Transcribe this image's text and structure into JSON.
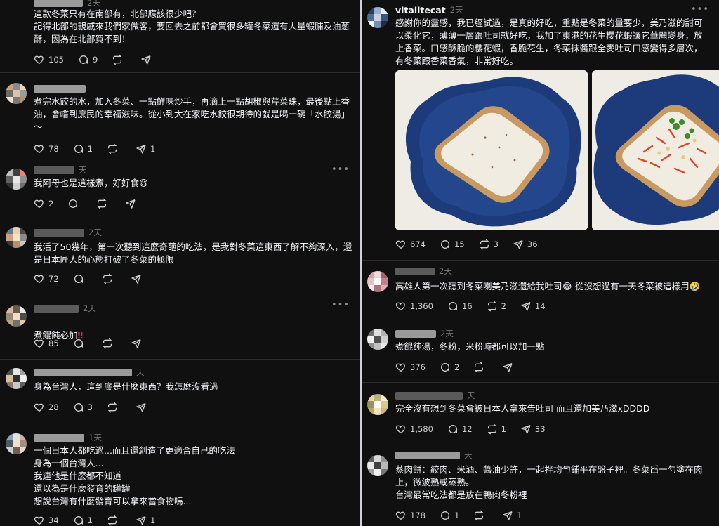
{
  "left": {
    "posts": [
      {
        "username": "",
        "time": "2天",
        "text": "這款冬菜只有在南部有，北部應該很少吧？\n記得北部的親戚來我們家做客，要回去之前都會買很多罐冬菜還有大量蝦脯及油蔥酥，因為在北部買不到！",
        "likes": "105",
        "replies": "9",
        "reposts": "",
        "shares": ""
      },
      {
        "username": "",
        "time": "",
        "text": "煮完水餃的水，加入冬菜、一點鮮味炒手，再滴上一點胡椒與芹菜珠，最後點上香油，會嚐到庶民的幸福滋味。從小到大在家吃水餃很期待的就是喝一碗「水餃湯」～",
        "likes": "78",
        "replies": "1",
        "reposts": "",
        "shares": "1"
      },
      {
        "username": "",
        "time": "天",
        "text": "我阿母也是這樣煮，好好食😋",
        "likes": "2",
        "replies": "",
        "reposts": "",
        "shares": ""
      },
      {
        "username": "",
        "time": "2天",
        "text": "我活了50幾年，第一次聽到這麼奇葩的吃法，是我對冬菜這東西了解不夠深入，還是日本匠人的心態打破了冬菜的極限",
        "likes": "72",
        "replies": "",
        "reposts": "",
        "shares": ""
      },
      {
        "username": "",
        "time": "2天",
        "text": "煮餛飩必加",
        "emoji": "‼",
        "likes": "85",
        "replies": "",
        "reposts": "",
        "shares": ""
      },
      {
        "username": "",
        "time": "天",
        "text": "身為台灣人，這到底是什麼東西？我怎麼沒看過",
        "likes": "28",
        "replies": "3",
        "reposts": "",
        "shares": ""
      },
      {
        "username": "",
        "time": "1天",
        "text": "一個日本人都吃過...而且還創造了更適合自己的吃法\n身為一個台灣人...\n我連他是什麼都不知道\n還以為是什麼發育的罐罐\n想說台灣有什麼發育可以拿來當食物嗎...",
        "likes": "34",
        "replies": "1",
        "reposts": "",
        "shares": "1"
      }
    ]
  },
  "right": {
    "main_post": {
      "username": "vitalitecat",
      "time": "2天",
      "text": "感謝你的靈感，我已經試過，是真的好吃，重點是冬菜的量要少，美乃滋的甜可以柔化它，薄薄一層跟吐司就好吃，我加了東港的花生櫻花蝦讓它華麗變身，放上香菜。口感酥脆的櫻花蝦，香脆花生，冬菜抹醬跟全麥吐司口感變得多層次，有冬菜跟香菜香氣，非常好吃。",
      "likes": "674",
      "replies": "15",
      "reposts": "3",
      "shares": "36",
      "images": [
        "toast-plain",
        "toast-topped"
      ]
    },
    "posts": [
      {
        "username": "",
        "time": "2天",
        "text": "高雄人第一次聽到冬菜喇美乃滋還給我吐司😂 從沒想過有一天冬菜被這樣用🤣",
        "likes": "1,360",
        "replies": "16",
        "reposts": "2",
        "shares": "14"
      },
      {
        "username": "",
        "time": "2天",
        "text": "煮餛飩湯，冬粉，米粉時都可以加一點",
        "likes": "376",
        "replies": "2",
        "reposts": "",
        "shares": ""
      },
      {
        "username": "",
        "time": "天",
        "text": "完全沒有想到冬菜會被日本人拿來告吐司 而且還加美乃滋xDDDD",
        "likes": "1,580",
        "replies": "12",
        "reposts": "1",
        "shares": "33"
      },
      {
        "username": "",
        "time": "天",
        "text": "蒸肉餅：絞肉、米酒、醬油少許，一起拌均勻鋪平在盤子裡。冬菜舀一勺塗在肉上，微波熟或蒸熟。\n台灣最常吃法都是放在鴨肉冬粉裡",
        "likes": "178",
        "replies": "1",
        "reposts": "",
        "shares": "1"
      }
    ]
  },
  "more_label": "•••",
  "icons": {
    "like": "heart-icon",
    "reply": "comment-icon",
    "repost": "repost-icon",
    "share": "share-icon"
  },
  "colors": {
    "background": "#101010",
    "text": "#f3f5f7",
    "muted": "#777777",
    "accent_red": "#e0245e"
  }
}
